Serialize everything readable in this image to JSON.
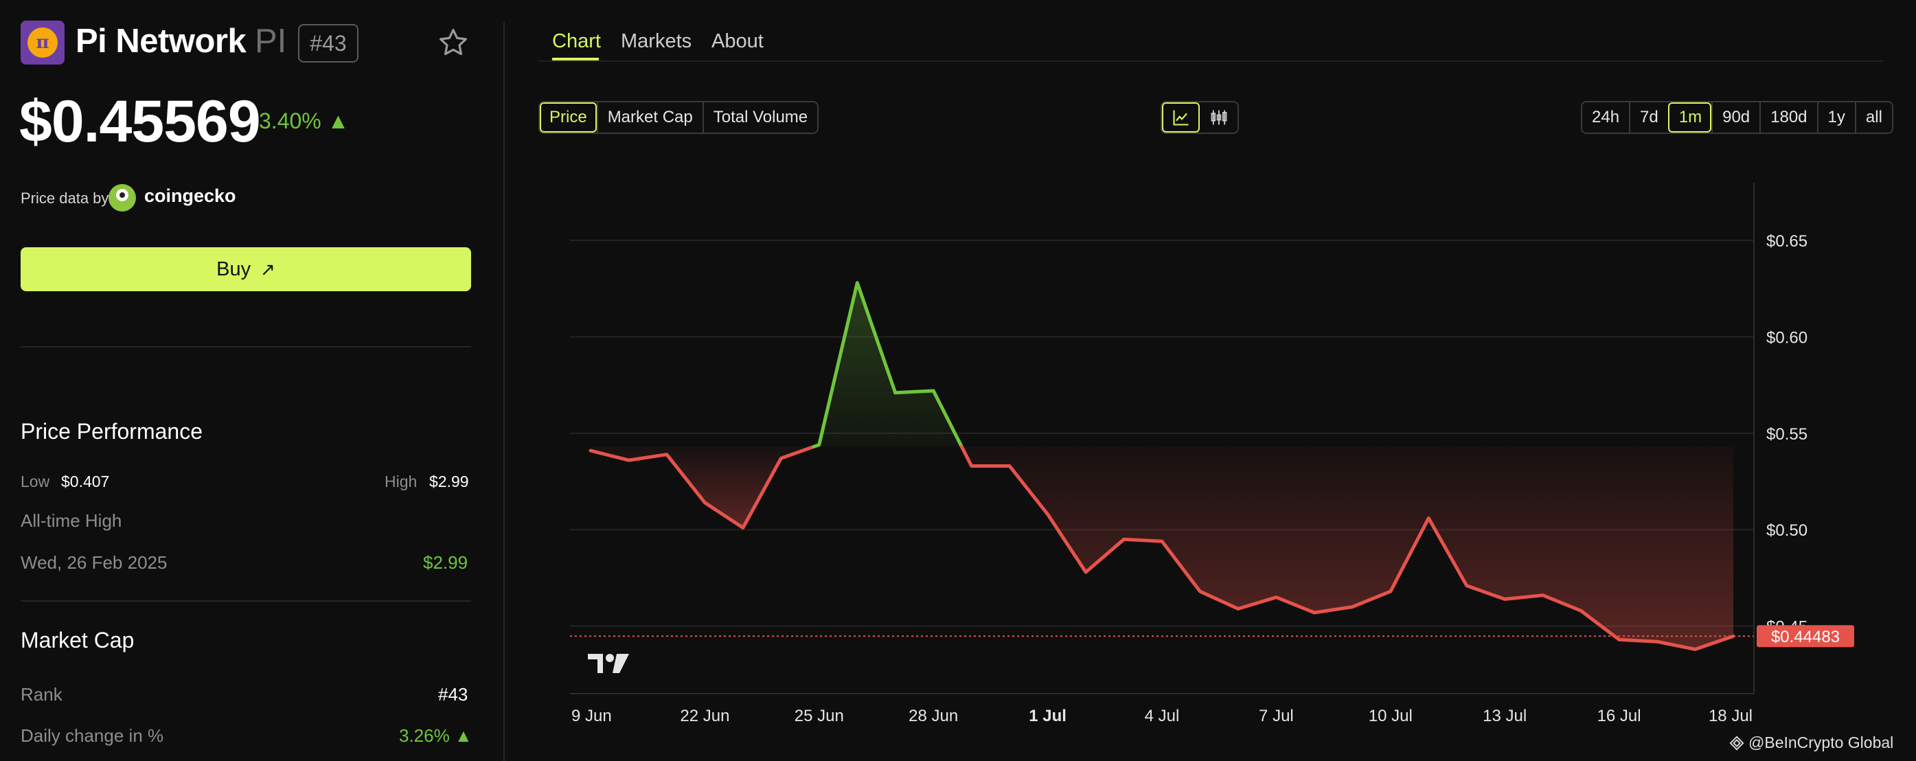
{
  "coin": {
    "name": "Pi Network",
    "symbol": "PI",
    "rank_badge": "#43",
    "logo_glyph": "π",
    "price": "$0.45569",
    "change": "3.40% ▲",
    "change_color": "#6fc43c"
  },
  "price_source": {
    "label": "Price data by",
    "provider": "coingecko"
  },
  "buy": {
    "label": "Buy",
    "arrow": "↗",
    "color": "#d6f75f"
  },
  "performance": {
    "title": "Price Performance",
    "low_label": "Low",
    "low_value": "$0.407",
    "high_label": "High",
    "high_value": "$2.99",
    "ath_label": "All-time High",
    "ath_date": "Wed, 26 Feb 2025",
    "ath_value": "$2.99"
  },
  "market_cap": {
    "title": "Market Cap",
    "rank_label": "Rank",
    "rank_value": "#43",
    "daily_label": "Daily change in %",
    "daily_value": "3.26% ▲"
  },
  "tabs": [
    {
      "label": "Chart",
      "active": true
    },
    {
      "label": "Markets",
      "active": false
    },
    {
      "label": "About",
      "active": false
    }
  ],
  "metric_toggle": [
    "Price",
    "Market Cap",
    "Total Volume"
  ],
  "metric_active": "Price",
  "chart_type_icons": [
    "line-chart-icon",
    "candlestick-icon"
  ],
  "ranges": [
    "24h",
    "7d",
    "1m",
    "90d",
    "180d",
    "1y",
    "all"
  ],
  "range_active": "1m",
  "watermark": "@BeInCrypto Global",
  "chart_data": {
    "type": "line",
    "x": [
      "19 Jun",
      "20 Jun",
      "21 Jun",
      "22 Jun",
      "23 Jun",
      "24 Jun",
      "25 Jun",
      "26 Jun",
      "27 Jun",
      "28 Jun",
      "29 Jun",
      "30 Jun",
      "1 Jul",
      "2 Jul",
      "3 Jul",
      "4 Jul",
      "5 Jul",
      "6 Jul",
      "7 Jul",
      "8 Jul",
      "9 Jul",
      "10 Jul",
      "11 Jul",
      "12 Jul",
      "13 Jul",
      "14 Jul",
      "15 Jul",
      "16 Jul",
      "17 Jul",
      "18 Jul",
      "19 Jul"
    ],
    "values": [
      0.541,
      0.536,
      0.539,
      0.514,
      0.501,
      0.537,
      0.544,
      0.628,
      0.571,
      0.572,
      0.533,
      0.533,
      0.508,
      0.478,
      0.495,
      0.494,
      0.468,
      0.459,
      0.465,
      0.457,
      0.46,
      0.468,
      0.506,
      0.471,
      0.464,
      0.466,
      0.458,
      0.443,
      0.442,
      0.438,
      0.44483
    ],
    "baseline": 0.543,
    "x_tick_labels": [
      "9 Jun",
      "22 Jun",
      "25 Jun",
      "28 Jun",
      "1 Jul",
      "4 Jul",
      "7 Jul",
      "10 Jul",
      "13 Jul",
      "16 Jul",
      "18 Jul"
    ],
    "x_tick_index": [
      0,
      3,
      6,
      9,
      12,
      15,
      18,
      21,
      24,
      27,
      30
    ],
    "y_ticks": [
      0.45,
      0.5,
      0.55,
      0.6,
      0.65
    ],
    "y_tick_labels": [
      "$0.45",
      "$0.50",
      "$0.55",
      "$0.60",
      "$0.65"
    ],
    "ylim": [
      0.415,
      0.682
    ],
    "current_price_label": "$0.44483",
    "current_price": 0.44483,
    "up_color": "#6fc43c",
    "down_color": "#e5534b",
    "grid": true
  }
}
